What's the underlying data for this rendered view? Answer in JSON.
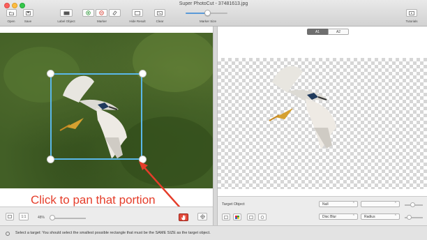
{
  "window": {
    "title": "Super PhotoCut - 37481613.jpg"
  },
  "toolbar": {
    "open_label": "Open",
    "save_label": "Save",
    "label_object_label": "Label Object",
    "marker_label": "Marker",
    "hide_result_label": "Hide Result",
    "clear_label": "Clear",
    "marker_size_label": "Marker Size",
    "tutorials_label": "Tutorials",
    "marker_size_value": 0.55
  },
  "right_pane": {
    "view_tabs": [
      "A1",
      "A2"
    ],
    "selected_tab": 0
  },
  "left_bottom": {
    "zoom_value": "48%",
    "fit_label": "1:1"
  },
  "right_bottom": {
    "target_object_label": "Target Object",
    "target_object_value": "Null",
    "disc_blur_label": "Disc Blur",
    "radius_label": "Radius"
  },
  "annotation": {
    "text": "Click to pan that portion"
  },
  "status": {
    "text": "Select a target: You should select the smallest possible rectangle that must be the SAME SIZE as the target object."
  },
  "colors": {
    "selection": "#5ab8ea",
    "annotation": "#e53d2a",
    "pan_button": "#e24a3b"
  }
}
